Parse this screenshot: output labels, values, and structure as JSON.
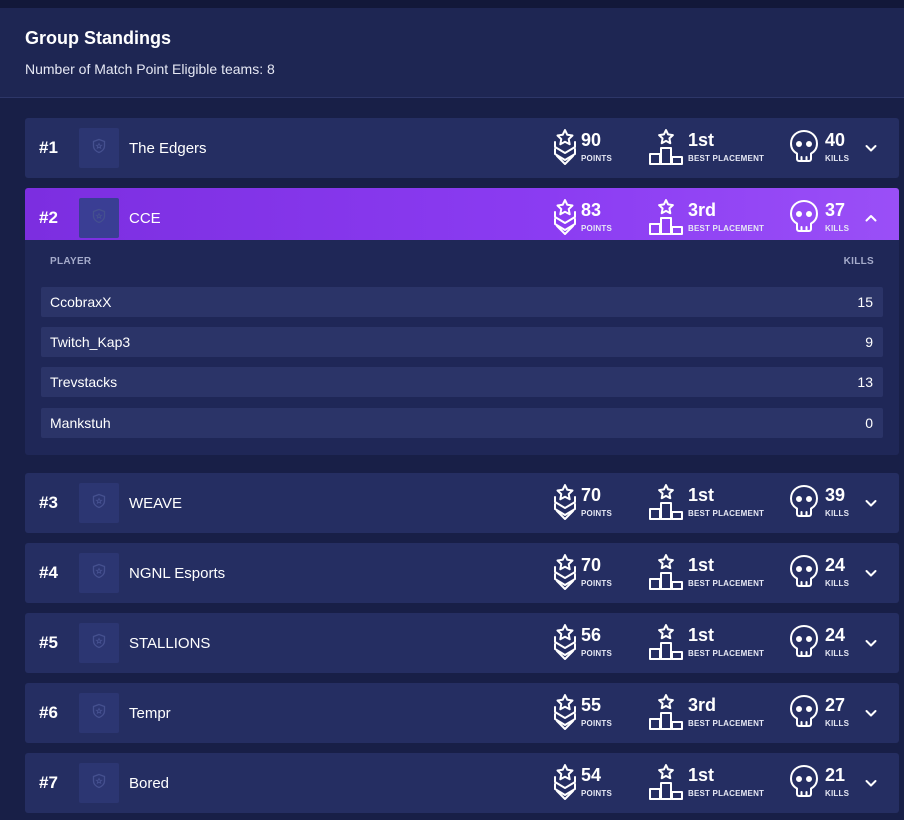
{
  "header": {
    "title": "Group Standings",
    "subtitle": "Number of Match Point Eligible teams: 8"
  },
  "labels": {
    "points": "POINTS",
    "best_placement": "BEST PLACEMENT",
    "kills": "KILLS",
    "player_col": "PLAYER",
    "kills_col": "KILLS"
  },
  "colors": {
    "background": "#181f47",
    "row": "#252e62",
    "active_row": "#8b3cf2"
  },
  "teams": [
    {
      "rank": "#1",
      "name": "The Edgers",
      "points": "90",
      "best_placement": "1st",
      "kills": "40",
      "expanded": false
    },
    {
      "rank": "#2",
      "name": "CCE",
      "points": "83",
      "best_placement": "3rd",
      "kills": "37",
      "expanded": true
    },
    {
      "rank": "#3",
      "name": "WEAVE",
      "points": "70",
      "best_placement": "1st",
      "kills": "39",
      "expanded": false
    },
    {
      "rank": "#4",
      "name": "NGNL Esports",
      "points": "70",
      "best_placement": "1st",
      "kills": "24",
      "expanded": false
    },
    {
      "rank": "#5",
      "name": "STALLIONS",
      "points": "56",
      "best_placement": "1st",
      "kills": "24",
      "expanded": false
    },
    {
      "rank": "#6",
      "name": "Tempr",
      "points": "55",
      "best_placement": "3rd",
      "kills": "27",
      "expanded": false
    },
    {
      "rank": "#7",
      "name": "Bored",
      "points": "54",
      "best_placement": "1st",
      "kills": "21",
      "expanded": false
    }
  ],
  "expanded_players": [
    {
      "name": "CcobraxX",
      "kills": "15"
    },
    {
      "name": "Twitch_Kap3",
      "kills": "9"
    },
    {
      "name": "Trevstacks",
      "kills": "13"
    },
    {
      "name": "Mankstuh",
      "kills": "0"
    }
  ],
  "icons": {
    "points": "chevron-rank-star-icon",
    "placement": "podium-star-icon",
    "kills": "skull-icon",
    "logo_placeholder": "shield-icon",
    "toggle_collapsed": "chevron-down-icon",
    "toggle_expanded": "chevron-up-icon"
  }
}
